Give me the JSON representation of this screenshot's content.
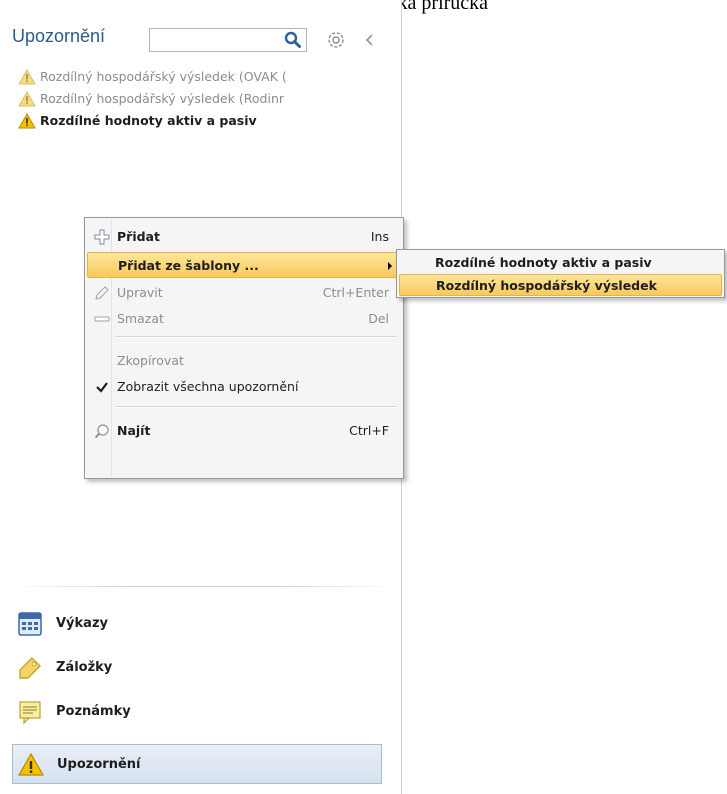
{
  "document": {
    "title": "Uživatelská příručka"
  },
  "panel": {
    "title": "Upozornění",
    "search": {
      "value": "",
      "placeholder": ""
    },
    "icons": {
      "search": "search-icon",
      "settings": "gear-icon",
      "collapse": "collapse-left-icon"
    }
  },
  "alerts": [
    {
      "label": "Rozdílný hospodářský výsledek  (OVAK (",
      "state": "dimmed",
      "icon": "warning-icon"
    },
    {
      "label": "Rozdílný hospodářský výsledek  (Rodinr",
      "state": "dimmed",
      "icon": "warning-icon"
    },
    {
      "label": "Rozdílné hodnoty aktiv a pasiv",
      "state": "active",
      "icon": "warning-icon"
    }
  ],
  "context_menu": {
    "items": [
      {
        "label": "Přidat",
        "shortcut": "Ins",
        "icon": "plus-icon",
        "enabled": true
      },
      {
        "label": "Přidat ze šablony ...",
        "shortcut": "",
        "submenu": true,
        "highlighted": true,
        "enabled": true
      },
      {
        "label": "Upravit",
        "shortcut": "Ctrl+Enter",
        "icon": "pencil-icon",
        "enabled": false
      },
      {
        "label": "Smazat",
        "shortcut": "Del",
        "icon": "minus-icon",
        "enabled": false
      },
      {
        "label": "Zkopírovat",
        "shortcut": "",
        "enabled": false
      },
      {
        "label": "Zobrazit všechna upozornění",
        "shortcut": "",
        "icon": "checkmark-icon",
        "checked": true,
        "enabled": true
      },
      {
        "label": "Najít",
        "shortcut": "Ctrl+F",
        "icon": "magnifier-icon",
        "enabled": true
      }
    ]
  },
  "submenu": {
    "items": [
      {
        "label": "Rozdílné hodnoty aktiv a pasiv",
        "highlighted": false
      },
      {
        "label": "Rozdílný hospodářský výsledek",
        "highlighted": true
      }
    ]
  },
  "nav": {
    "items": [
      {
        "label": "Výkazy",
        "icon": "report-table-icon",
        "selected": false
      },
      {
        "label": "Záložky",
        "icon": "bookmark-tag-icon",
        "selected": false
      },
      {
        "label": "Poznámky",
        "icon": "note-icon",
        "selected": false
      },
      {
        "label": "Upozornění",
        "icon": "warning-icon",
        "selected": true
      }
    ]
  },
  "colors": {
    "accent_title": "#2b5a8e",
    "menu_highlight": "#f9c95b",
    "nav_selected": "#d6e2ef",
    "warning": "#f2c200"
  }
}
